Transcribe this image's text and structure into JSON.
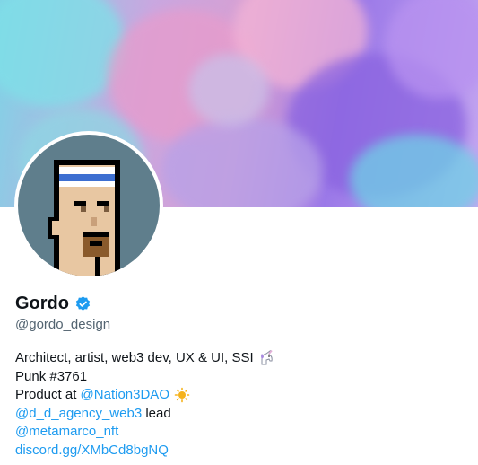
{
  "profile": {
    "name": "Gordo",
    "handle": "@gordo_design"
  },
  "bio": {
    "line1": "Architect, artist, web3 dev, UX & UI, SSI",
    "line2": "Punk #3761",
    "line3_prefix": "Product at ",
    "line3_link": "@Nation3DAO",
    "line4_link": "@d_d_agency_web3",
    "line4_suffix": " lead",
    "line5_link": "@metamarco_nft",
    "line6_link": "discord.gg/XMbCd8bgNQ"
  },
  "icons": {
    "verified": "verified-badge-icon",
    "unicorn": "unicorn-emoji-icon",
    "sun": "sun-emoji-icon"
  },
  "colors": {
    "link": "#1d9bf0",
    "verified": "#1d9bf0",
    "handle": "#536471",
    "avatar_bg": "#5f7e8c"
  }
}
